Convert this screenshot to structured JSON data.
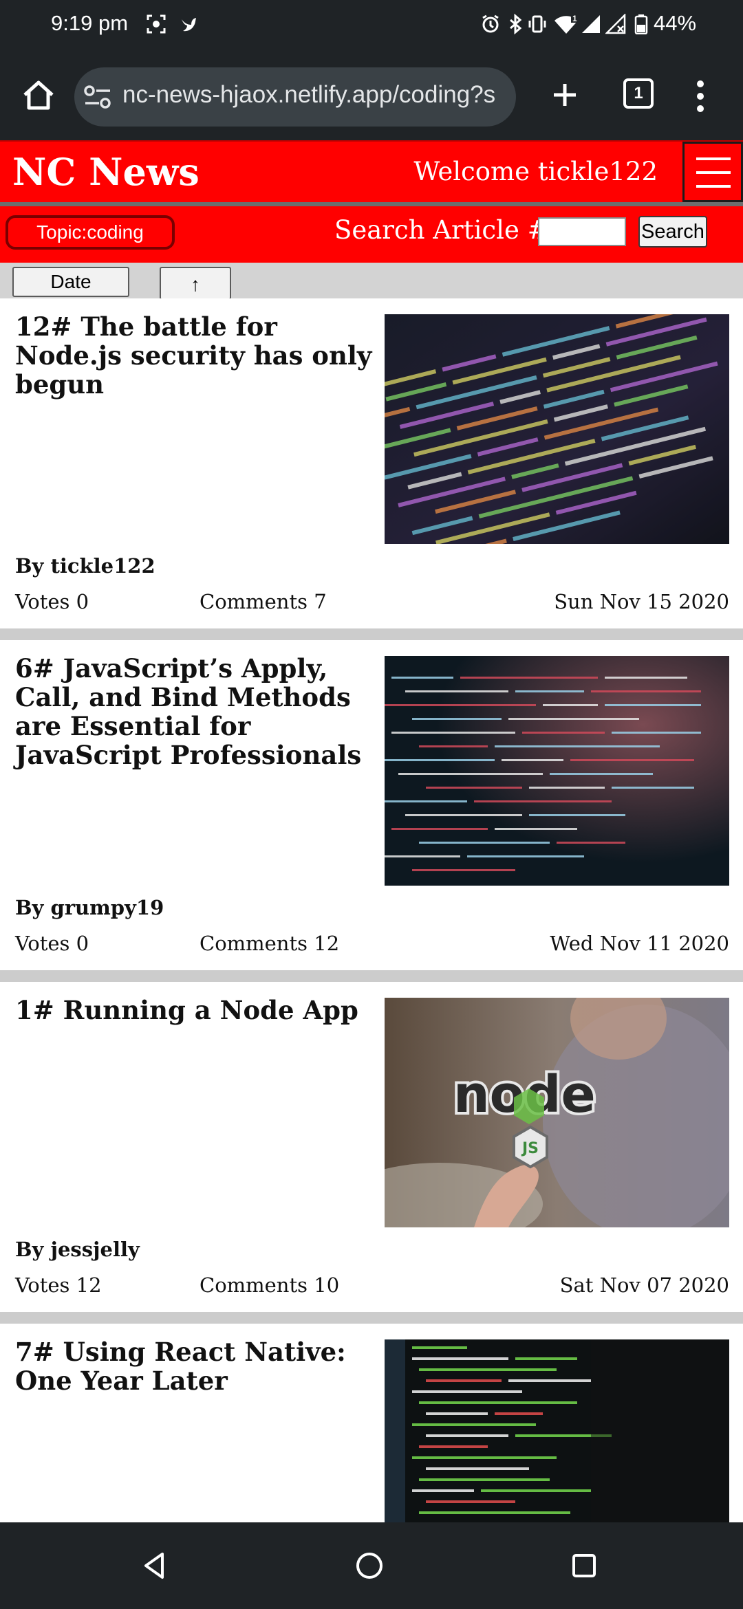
{
  "status_bar": {
    "time": "9:19 pm",
    "battery_percent": "44%",
    "icons": [
      "screenshot-icon",
      "bird-icon",
      "alarm-icon",
      "bluetooth-icon",
      "vibrate-icon",
      "wifi-icon",
      "signal-icon",
      "signal-x-icon",
      "battery-icon"
    ]
  },
  "browser": {
    "url": "nc-news-hjaox.netlify.app/coding?s",
    "tab_count": "1"
  },
  "header": {
    "title": "NC News",
    "welcome": "Welcome tickle122"
  },
  "toolbar": {
    "topic_label": "Topic:coding",
    "search_label": "Search Article #:",
    "search_value": "",
    "search_button": "Search"
  },
  "sort": {
    "field_label": "Date",
    "order_label": "↑"
  },
  "articles": [
    {
      "title": "12# The battle for Node.js security has only begun",
      "author": "By tickle122",
      "votes": "Votes 0",
      "comments": "Comments 7",
      "date": "Sun Nov 15 2020"
    },
    {
      "title": "6# JavaScript’s Apply, Call, and Bind Methods are Essential for JavaScript Professionals",
      "author": "By grumpy19",
      "votes": "Votes 0",
      "comments": "Comments 12",
      "date": "Wed Nov 11 2020"
    },
    {
      "title": "1# Running a Node App",
      "author": "By jessjelly",
      "votes": "Votes 12",
      "comments": "Comments 10",
      "date": "Sat Nov 07 2020"
    },
    {
      "title": "7# Using React Native: One Year Later",
      "author": "",
      "votes": "",
      "comments": "",
      "date": ""
    }
  ],
  "thumb_image": {
    "logo_text": "node",
    "logo_sub": "JS"
  },
  "colors": {
    "brand_red": "#ff0000",
    "system_bar": "#1f2326",
    "sort_bar": "#d3d3d3",
    "separator": "#cccccc"
  }
}
